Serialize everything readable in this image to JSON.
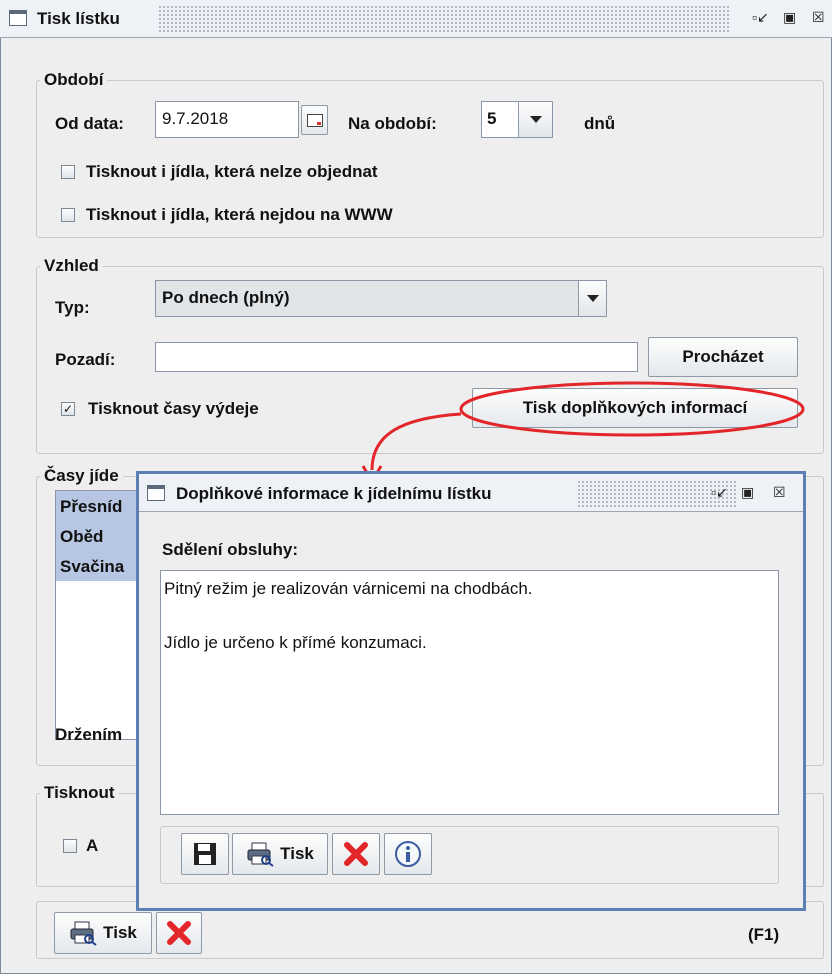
{
  "main_window": {
    "title": "Tisk lístku",
    "controls": [
      "▫⌟",
      "◳",
      "☒"
    ],
    "period": {
      "legend": "Období",
      "from_label": "Od data:",
      "from_value": "9.7.2018",
      "period_label": "Na období:",
      "period_value": "5",
      "days_label": "dnů",
      "chk_not_orderable": "Tisknout i jídla, která nelze objednat",
      "chk_not_www": "Tisknout i jídla, která nejdou na WWW"
    },
    "look": {
      "legend": "Vzhled",
      "type_label": "Typ:",
      "type_value": "Po dnech (plný)",
      "background_label": "Pozadí:",
      "background_value": "",
      "browse_label": "Procházet",
      "chk_times_label": "Tisknout časy výdeje",
      "extra_info_button": "Tisk doplňkových informací"
    },
    "times": {
      "legend": "Časy jíde",
      "items": [
        "Přesníd",
        "Oběd",
        "Svačina"
      ],
      "hint": "Držením"
    },
    "print_group": {
      "legend": "Tisknout",
      "chk_a": "A"
    },
    "toolbar": {
      "print_label": "Tisk",
      "shortcut": "(F1)"
    }
  },
  "dialog": {
    "title": "Doplňkové informace k jídelnímu lístku",
    "message_label": "Sdělení obsluhy:",
    "line1": "Pitný režim je realizován várnicemi na chodbách.",
    "line2": "Jídlo je určeno k přímé konzumaci.",
    "print_label": "Tisk"
  },
  "colors": {
    "annotation": "#e3262a",
    "dialog_border": "#5e7fb3",
    "selection": "#b7c7e3"
  }
}
